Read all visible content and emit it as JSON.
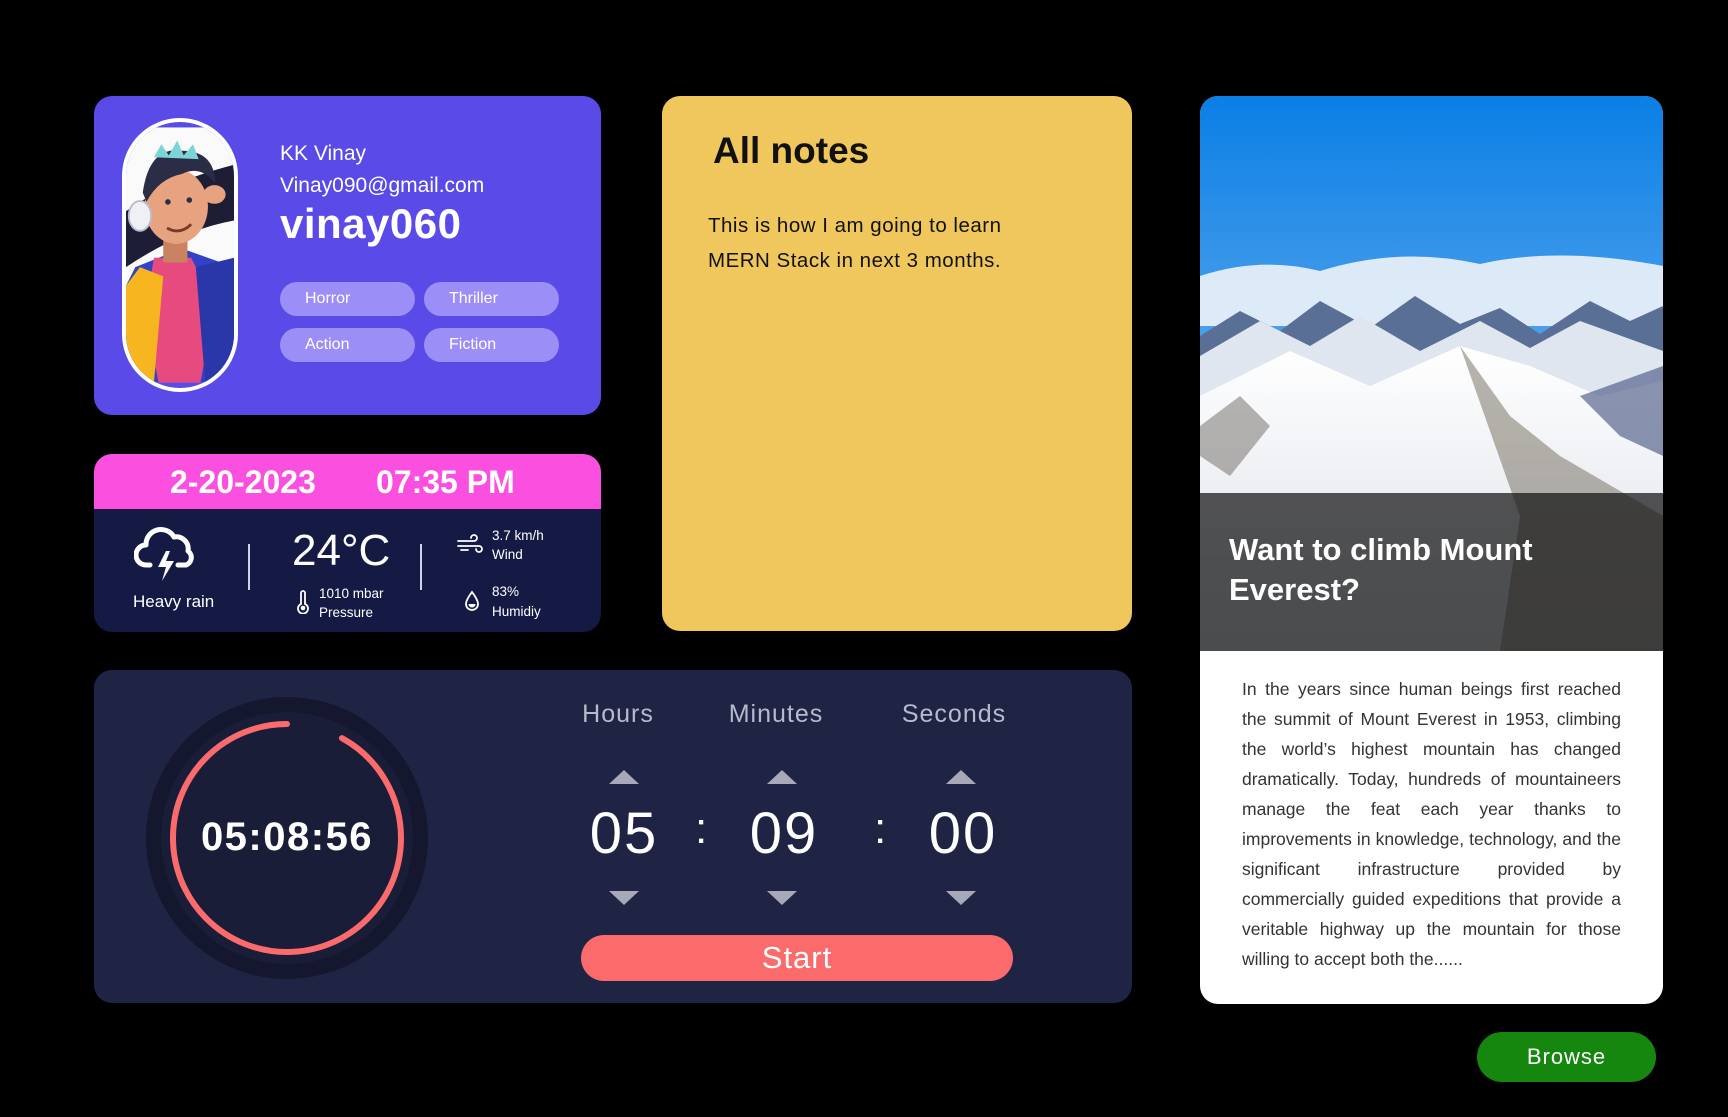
{
  "profile": {
    "name": "KK Vinay",
    "email": "Vinay090@gmail.com",
    "username": "vinay060",
    "tags": [
      "Horror",
      "Thriller",
      "Action",
      "Fiction"
    ]
  },
  "weather": {
    "date": "2-20-2023",
    "time": "07:35 PM",
    "condition": "Heavy rain",
    "temperature": "24°C",
    "pressure_value": "1010 mbar",
    "pressure_label": "Pressure",
    "wind_value": "3.7 km/h",
    "wind_label": "Wind",
    "humidity_value": "83%",
    "humidity_label": "Humidiy"
  },
  "notes": {
    "title": "All notes",
    "body": "This is how I am going to learn MERN Stack in next 3 months."
  },
  "timer": {
    "display": "05:08:56",
    "hours_label": "Hours",
    "minutes_label": "Minutes",
    "seconds_label": "Seconds",
    "hours": "05",
    "minutes": "09",
    "seconds": "00",
    "separator": ":",
    "progress_fraction": 0.92,
    "start_label": "Start",
    "accent": "#fb6b6b"
  },
  "article": {
    "title": "Want to climb Mount Everest?",
    "body": "In the years since human beings first reached the summit of Mount Everest in 1953, climbing the world’s highest mountain has changed dramatically. Today, hundreds of mountaineers manage the feat each year thanks to improvements in knowledge, technology, and the significant infrastructure provided by commercially guided expeditions that provide a veritable highway up the mountain for those willing to accept both the......"
  },
  "browse_label": "Browse",
  "colors": {
    "profile_bg": "#5a4ae8",
    "weather_header": "#fb4fe0",
    "notes_bg": "#f0c75d",
    "timer_bg": "#202444",
    "browse_bg": "#16870e"
  },
  "icons": [
    "avatar-illustration",
    "storm-cloud-icon",
    "thermometer-icon",
    "wind-icon",
    "humidity-drop-icon",
    "arrow-up-icon",
    "arrow-down-icon"
  ]
}
